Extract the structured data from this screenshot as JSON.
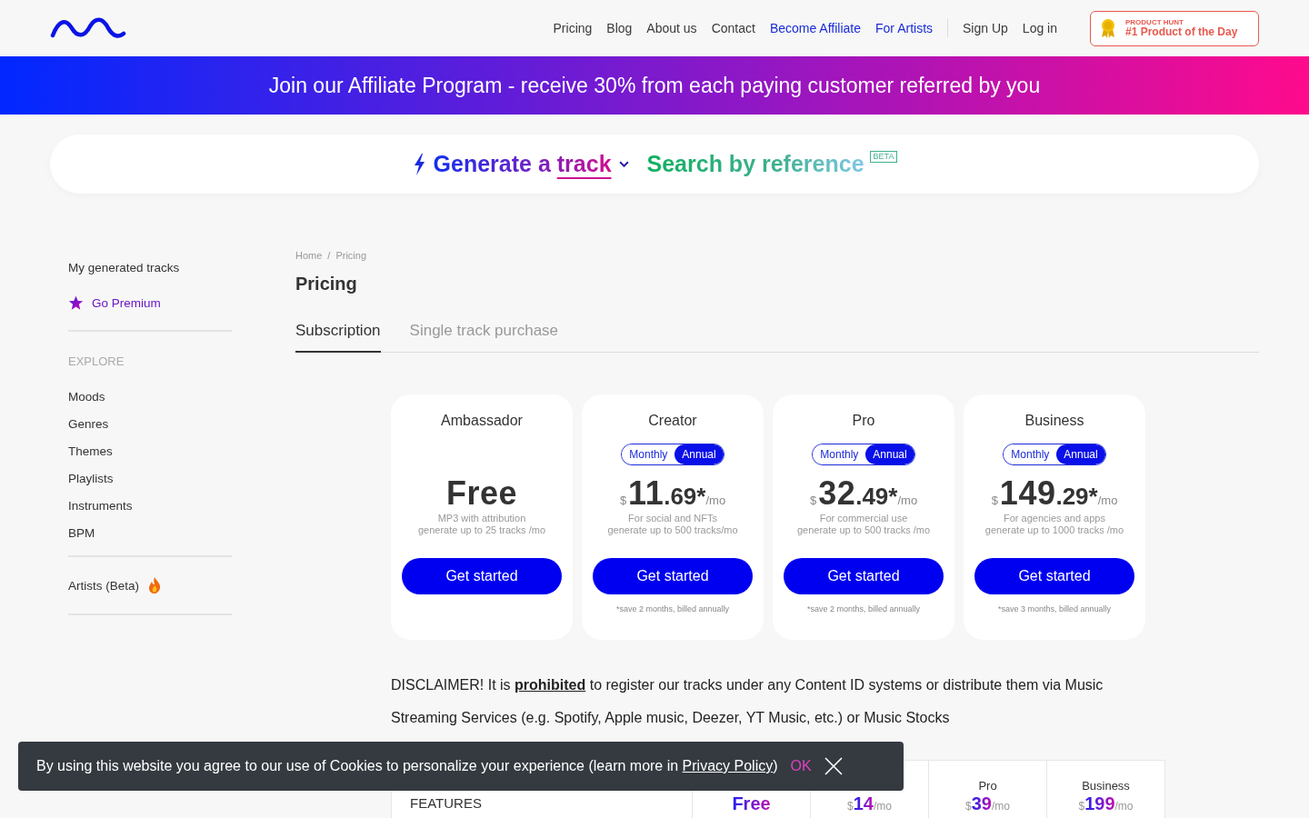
{
  "header": {
    "nav": [
      {
        "label": "Pricing",
        "kind": "plain"
      },
      {
        "label": "Blog",
        "kind": "plain"
      },
      {
        "label": "About us",
        "kind": "plain"
      },
      {
        "label": "Contact",
        "kind": "plain"
      },
      {
        "label": "Become Affiliate",
        "kind": "accent"
      },
      {
        "label": "For Artists",
        "kind": "accent"
      }
    ],
    "auth": [
      "Sign Up",
      "Log in"
    ],
    "award": {
      "overline": "PRODUCT HUNT",
      "title": "#1 Product of the Day"
    }
  },
  "promo_banner": "Join our Affiliate Program - receive 30% from each paying customer referred by you",
  "generator": {
    "title": "Generate a",
    "title_link": "track",
    "search": "Search by reference",
    "badge": "BETA"
  },
  "sidebar": {
    "top": [
      {
        "label": "My generated tracks",
        "kind": "plain"
      },
      {
        "label": "Go Premium",
        "kind": "premium"
      }
    ],
    "section_title": "EXPLORE",
    "items": [
      "Moods",
      "Genres",
      "Themes",
      "Playlists",
      "Instruments",
      "BPM"
    ],
    "artists": "Artists (Beta)"
  },
  "breadcrumb": {
    "items": [
      "Home",
      "Pricing"
    ],
    "separator": "/"
  },
  "page_title": "Pricing",
  "tabs": [
    {
      "label": "Subscription",
      "selected": true
    },
    {
      "label": "Single track purchase",
      "selected": false
    }
  ],
  "plans": [
    {
      "name": "Ambassador",
      "amount": "Free",
      "line1": "MP3 with attribution",
      "line2": "generate up to 25 tracks /mo",
      "button": "Get started"
    },
    {
      "name": "Creator",
      "billing": [
        {
          "label": "Monthly",
          "selected": false
        },
        {
          "label": "Annual",
          "selected": true
        }
      ],
      "currency": "$",
      "amount": "11",
      "fraction": ".69*",
      "unit": "/mo",
      "line1": "For social and NFTs",
      "line2": "generate up to 500 tracks/mo",
      "button": "Get started",
      "note": "*save 2 months, billed annually"
    },
    {
      "name": "Pro",
      "billing": [
        {
          "label": "Monthly",
          "selected": false
        },
        {
          "label": "Annual",
          "selected": true
        }
      ],
      "currency": "$",
      "amount": "32",
      "fraction": ".49*",
      "unit": "/mo",
      "line1": "For commercial use",
      "line2": "generate up to 500 tracks /mo",
      "button": "Get started",
      "note": "*save 2 months, billed annually"
    },
    {
      "name": "Business",
      "billing": [
        {
          "label": "Monthly",
          "selected": false
        },
        {
          "label": "Annual",
          "selected": true
        }
      ],
      "currency": "$",
      "amount": "149",
      "fraction": ".29*",
      "unit": "/mo",
      "line1": "For agencies and apps",
      "line2": "generate up to 1000 tracks /mo",
      "button": "Get started",
      "note": "*save 3 months, billed annually"
    }
  ],
  "disclaimer": {
    "before": "DISCLAIMER! It is",
    "link": "prohibited",
    "after": "to register our tracks under any Content ID systems or distribute them via Music Streaming Services (e.g. Spotify, Apple music, Deezer, YT Music, etc.) or Music Stocks"
  },
  "comparison": {
    "features_heading": "FEATURES",
    "columns": [
      {
        "amount": "Free"
      },
      {
        "currency": "$",
        "amount": "14",
        "unit": "/mo"
      },
      {
        "name": "Pro",
        "currency": "$",
        "amount": "39",
        "unit": "/mo"
      },
      {
        "name": "Business",
        "currency": "$",
        "amount": "199",
        "unit": "/mo"
      }
    ]
  },
  "cookie_banner": {
    "before": "By using this website you agree to our use of Cookies to personalize your experience (learn more in",
    "link": "Privacy Policy",
    "after": ")",
    "ok": "OK"
  }
}
